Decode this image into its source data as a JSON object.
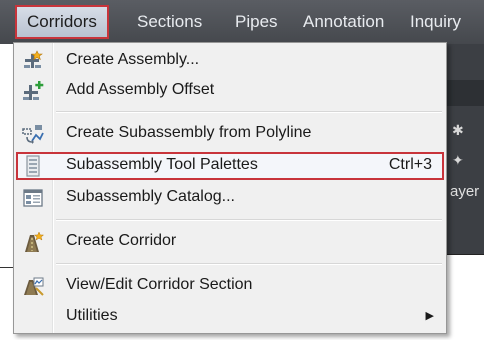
{
  "menubar": {
    "items": [
      "Corridors",
      "Sections",
      "Pipes",
      "Annotation",
      "Inquiry"
    ]
  },
  "background": {
    "partial_text": "ayer"
  },
  "dropdown": {
    "items": [
      {
        "label": "Create Assembly...",
        "icon": "create-assembly-icon"
      },
      {
        "label": "Add Assembly Offset",
        "icon": "add-assembly-offset-icon"
      },
      {
        "label": "Create Subassembly from Polyline",
        "icon": "subassembly-polyline-icon"
      },
      {
        "label": "Subassembly Tool Palettes",
        "shortcut": "Ctrl+3",
        "icon": "tool-palettes-icon"
      },
      {
        "label": "Subassembly Catalog...",
        "icon": "catalog-icon"
      },
      {
        "label": "Create Corridor",
        "icon": "create-corridor-icon"
      },
      {
        "label": "View/Edit Corridor Section",
        "icon": "corridor-section-icon"
      },
      {
        "label": "Utilities",
        "submenu": true
      }
    ]
  },
  "colors": {
    "highlight_border": "#c8343b",
    "menubar_bg": "#4f5257"
  }
}
